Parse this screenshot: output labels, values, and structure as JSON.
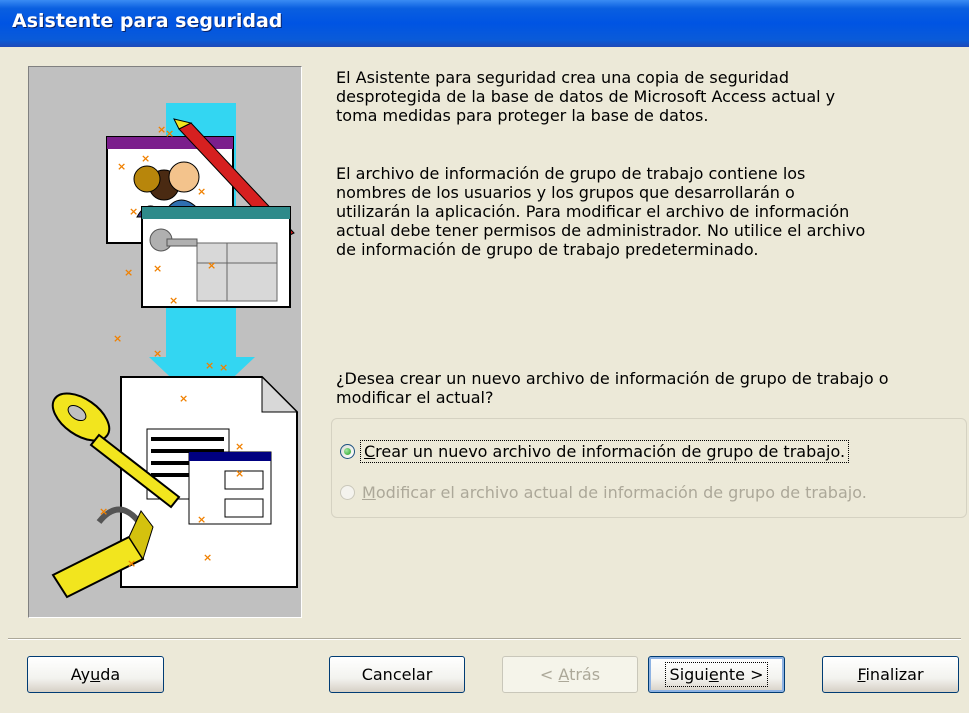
{
  "window": {
    "title": "Asistente para seguridad"
  },
  "text": {
    "paragraph1": "El Asistente para seguridad crea una copia de seguridad\ndesprotegida de la base de datos de Microsoft Access actual y\ntoma medidas para proteger la base de datos.",
    "paragraph2": "El archivo de información de grupo de trabajo contiene los\nnombres de los usuarios y los grupos que desarrollarán o\nutilizarán la aplicación. Para modificar el archivo de información\nactual debe tener permisos de administrador. No utilice el archivo\nde información de grupo de trabajo predeterminado.",
    "question": "¿Desea crear un nuevo archivo de información de grupo de trabajo o\nmodificar el actual?"
  },
  "options": [
    {
      "label_accel": "C",
      "label_rest": "rear un nuevo archivo de información de grupo de trabajo.",
      "checked": true,
      "enabled": true
    },
    {
      "label_accel": "M",
      "label_rest": "odificar el archivo actual de información de grupo de trabajo.",
      "checked": false,
      "enabled": false
    }
  ],
  "buttons": {
    "help": {
      "pre": "Ay",
      "accel": "u",
      "post": "da",
      "enabled": true
    },
    "cancel": {
      "pre": "Cancelar",
      "accel": "",
      "post": "",
      "enabled": true
    },
    "back": {
      "pre": "< ",
      "accel": "A",
      "post": "trás",
      "enabled": false
    },
    "next": {
      "pre": "Sigui",
      "accel": "e",
      "post": "nte >",
      "enabled": true,
      "default": true
    },
    "finish": {
      "pre": "",
      "accel": "F",
      "post": "inalizar",
      "enabled": true
    }
  },
  "icons": [
    "workgroup-users-icon",
    "security-key-icon",
    "padlock-icon",
    "database-form-icon"
  ],
  "colors": {
    "titlebar": "#0054E3",
    "illustration_bg": "#C0C0C0",
    "arrow": "#33D6F2",
    "key": "#F2E51E",
    "window_title": "#7B1E8C",
    "window_title_alt": "#2E8A8A",
    "doc_title": "#000080"
  }
}
